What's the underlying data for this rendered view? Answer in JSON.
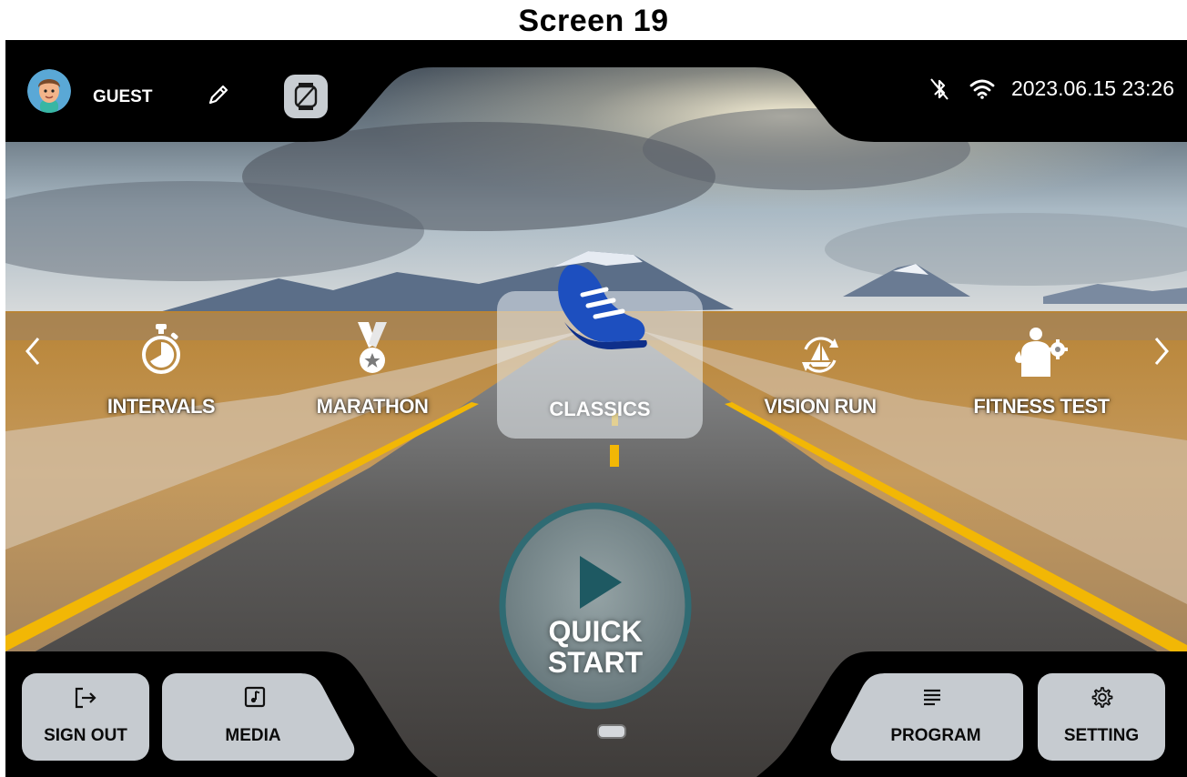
{
  "page_title": "Screen 19",
  "header": {
    "user_name": "GUEST",
    "datetime": "2023.06.15 23:26"
  },
  "modes": [
    {
      "label": "INTERVALS",
      "icon": "stopwatch-icon"
    },
    {
      "label": "MARATHON",
      "icon": "medal-icon"
    },
    {
      "label": "CLASSICS",
      "icon": "running-shoe-icon",
      "selected": true
    },
    {
      "label": "VISION RUN",
      "icon": "sailboat-cycle-icon"
    },
    {
      "label": "FITNESS TEST",
      "icon": "athlete-gear-icon"
    }
  ],
  "quick_start": {
    "line1": "QUICK",
    "line2": "START"
  },
  "bottom": {
    "sign_out": "SIGN OUT",
    "media": "MEDIA",
    "program": "PROGRAM",
    "setting": "SETTING"
  },
  "colors": {
    "road_line": "#f2b705",
    "shoe_blue": "#1d4fbf",
    "button_gray": "#c6cbd0",
    "quick_start_ring": "#2f6b73"
  }
}
